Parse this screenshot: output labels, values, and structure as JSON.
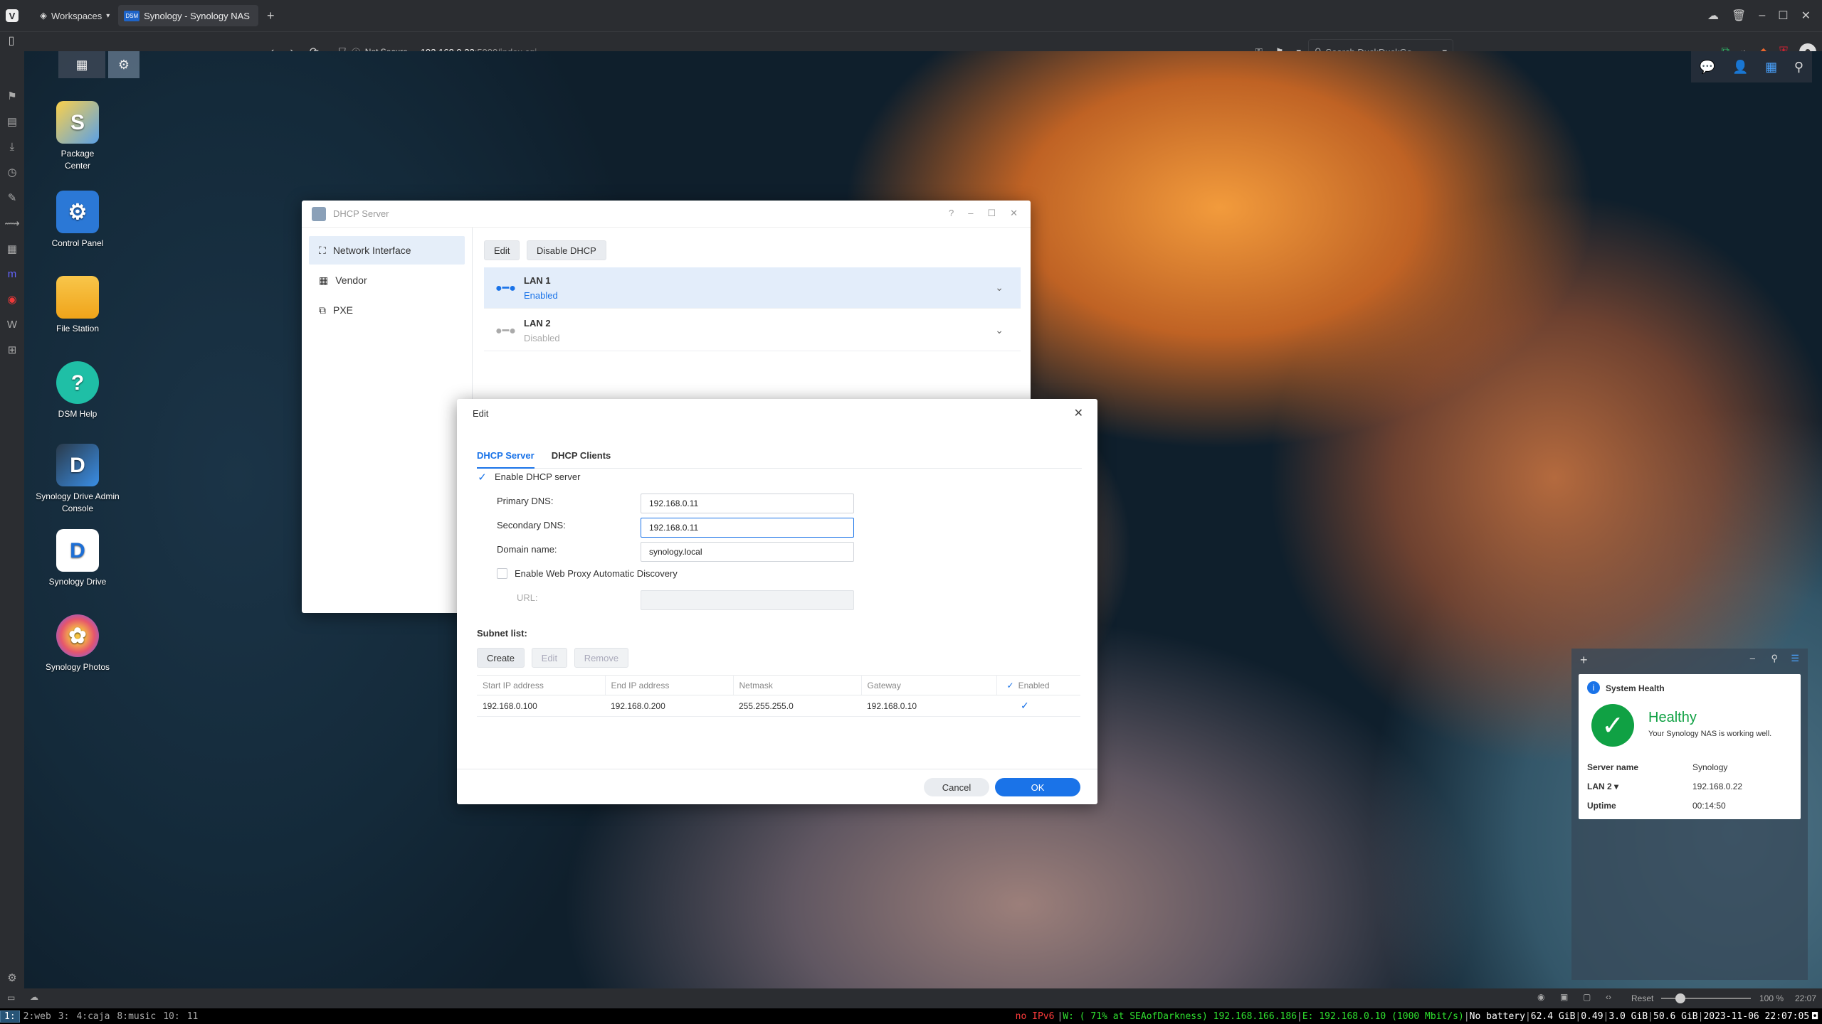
{
  "browser": {
    "workspaces_label": "Workspaces",
    "tab_title": "Synology - Synology NAS",
    "tab_favicon": "DSM",
    "security_label": "Not Secure",
    "url_host": "192.168.0.22",
    "url_path": ":5000/index.cgi",
    "search_placeholder": "Search DuckDuckGo"
  },
  "desktop_icons": [
    {
      "label": "Package Center",
      "glyph": "S",
      "color": "#5aa0e6"
    },
    {
      "label": "Control Panel",
      "glyph": "⚙",
      "color": "#2b78d6"
    },
    {
      "label": "File Station",
      "glyph": "",
      "color": "#f5b21e"
    },
    {
      "label": "DSM Help",
      "glyph": "?",
      "color": "#1fbfa6"
    },
    {
      "label": "Synology Drive Admin Console",
      "glyph": "D",
      "color": "#1e3c5a"
    },
    {
      "label": "Synology Drive",
      "glyph": "D",
      "color": "#1d6fd6"
    },
    {
      "label": "Synology Photos",
      "glyph": "✿",
      "color": "#f2a03b"
    }
  ],
  "dhcp_window": {
    "title": "DHCP Server",
    "sidebar": [
      "Network Interface",
      "Vendor",
      "PXE"
    ],
    "toolbar": {
      "edit": "Edit",
      "disable": "Disable DHCP"
    },
    "interfaces": [
      {
        "name": "LAN 1",
        "status": "Enabled"
      },
      {
        "name": "LAN 2",
        "status": "Disabled"
      }
    ]
  },
  "edit_dialog": {
    "title": "Edit",
    "tabs": [
      "DHCP Server",
      "DHCP Clients"
    ],
    "enable_label": "Enable DHCP server",
    "primary_dns_label": "Primary DNS:",
    "primary_dns": "192.168.0.11",
    "secondary_dns_label": "Secondary DNS:",
    "secondary_dns": "192.168.0.11",
    "domain_label": "Domain name:",
    "domain": "synology.local",
    "wpad_label": "Enable Web Proxy Automatic Discovery",
    "url_label": "URL:",
    "subnet_label": "Subnet list:",
    "subnet_buttons": {
      "create": "Create",
      "edit": "Edit",
      "remove": "Remove"
    },
    "columns": [
      "Start IP address",
      "End IP address",
      "Netmask",
      "Gateway",
      "Enabled"
    ],
    "rows": [
      [
        "192.168.0.100",
        "192.168.0.200",
        "255.255.255.0",
        "192.168.0.10"
      ]
    ],
    "cancel": "Cancel",
    "ok": "OK"
  },
  "health": {
    "title": "System Health",
    "status": "Healthy",
    "message": "Your Synology NAS is working well.",
    "server_name_label": "Server name",
    "server_name": "Synology",
    "lan_label": "LAN 2",
    "lan_ip": "192.168.0.22",
    "uptime_label": "Uptime",
    "uptime": "00:14:50"
  },
  "statusbar": {
    "reset": "Reset",
    "zoom": "100 %",
    "clock": "22:07"
  },
  "i3bar": {
    "workspaces": [
      "1:",
      "2:web",
      "3:",
      "4:caja",
      "8:music",
      "10:",
      "11"
    ],
    "ipv6": "no IPv6",
    "wifi": "W: ( 71% at SEAofDarkness) 192.168.166.186",
    "eth": "E: 192.168.0.10 (1000 Mbit/s)",
    "battery": "No battery",
    "disk": "62.4 GiB",
    "load": "0.49",
    "mem": "3.0 GiB",
    "disk2": "50.6 GiB",
    "datetime": "2023-11-06 22:07:05"
  },
  "colors": {
    "accent": "#1a73e8",
    "healthy": "#10a144",
    "i3_red": "#ff3b3b",
    "i3_green": "#2fe02f"
  }
}
